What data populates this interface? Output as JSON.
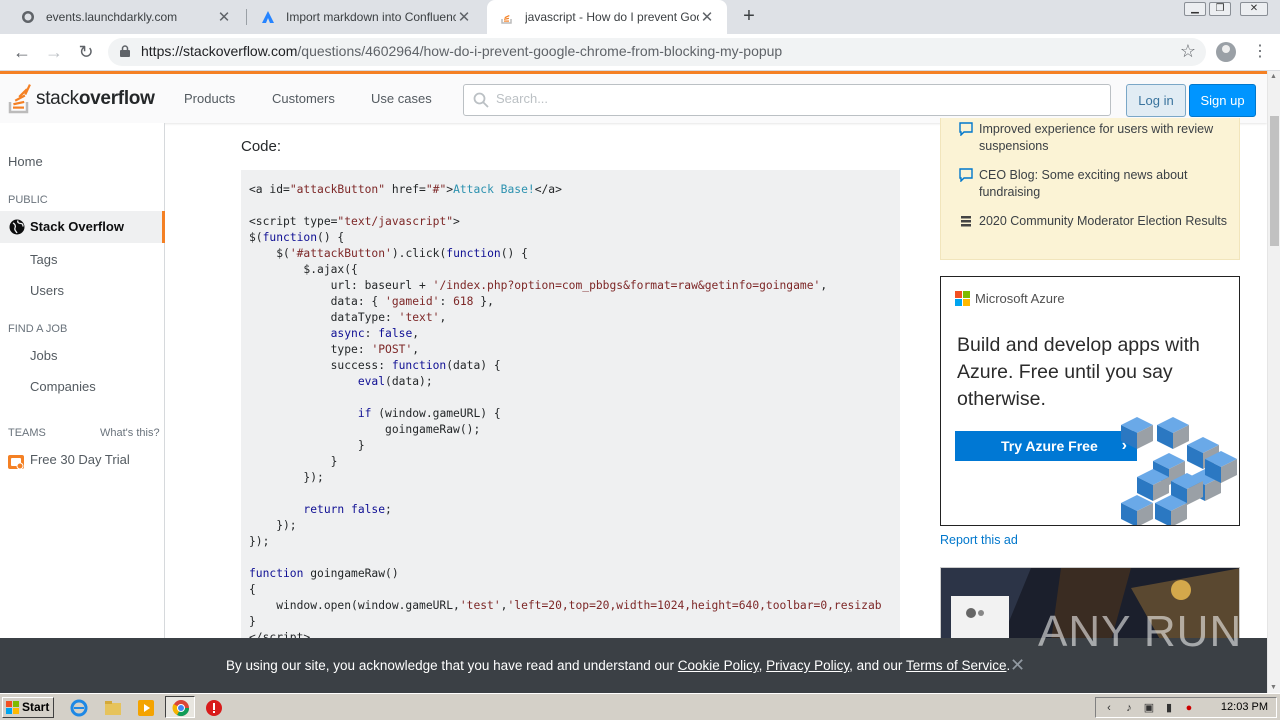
{
  "browser": {
    "tabs": [
      {
        "title": "events.launchdarkly.com",
        "active": false
      },
      {
        "title": "Import markdown into Confluence",
        "active": false
      },
      {
        "title": "javascript - How do I prevent Googl",
        "active": true
      }
    ],
    "url_host": "https://stackoverflow.com",
    "url_path": "/questions/4602964/how-do-i-prevent-google-chrome-from-blocking-my-popup"
  },
  "topbar": {
    "logo_light": "stack",
    "logo_bold": "overflow",
    "nav": [
      "Products",
      "Customers",
      "Use cases"
    ],
    "search_placeholder": "Search...",
    "login": "Log in",
    "signup": "Sign up"
  },
  "leftnav": {
    "home": "Home",
    "public_head": "PUBLIC",
    "stack_overflow": "Stack Overflow",
    "tags": "Tags",
    "users": "Users",
    "find_job_head": "FIND A JOB",
    "jobs": "Jobs",
    "companies": "Companies",
    "teams_head": "TEAMS",
    "whats_this": "What's this?",
    "free_trial": "Free 30 Day Trial"
  },
  "main": {
    "code_label": "Code:"
  },
  "blog": {
    "items": [
      "Improved experience for users with review suspensions",
      "CEO Blog: Some exciting news about fundraising",
      "2020 Community Moderator Election Results"
    ]
  },
  "ad": {
    "brand": "Microsoft Azure",
    "headline": "Build and develop apps with Azure. Free until you say otherwise.",
    "button": "Try Azure Free",
    "report": "Report this ad"
  },
  "cookie": {
    "prefix": "By using our site, you acknowledge that you have read and understand our ",
    "cookie_policy": "Cookie Policy",
    "sep1": ", ",
    "privacy_policy": "Privacy Policy",
    "sep2": ", and our ",
    "terms": "Terms of Service",
    "suffix": "."
  },
  "watermark": "ANY RUN",
  "taskbar": {
    "start": "Start",
    "clock": "12:03 PM"
  },
  "colors": {
    "so_orange": "#f48024",
    "so_blue": "#0095ff",
    "azure_blue": "#0078d4",
    "blog_yellow": "#fbf3d5",
    "cookie_bg": "#3b4045"
  }
}
